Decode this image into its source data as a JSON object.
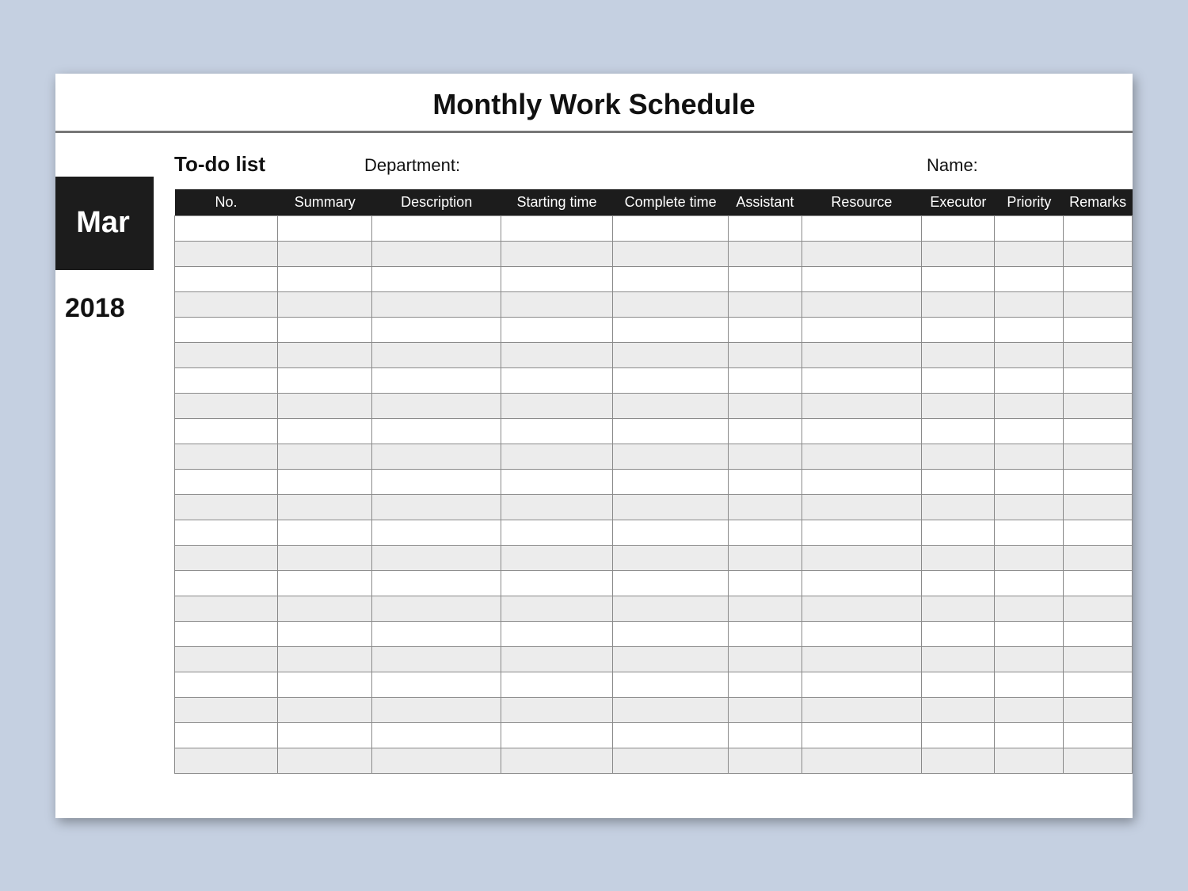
{
  "title": "Monthly Work Schedule",
  "sidebar": {
    "month": "Mar",
    "year": "2018"
  },
  "meta": {
    "list_label": "To-do list",
    "department_label": "Department:",
    "name_label": "Name:"
  },
  "columns": {
    "no": "No.",
    "summary": "Summary",
    "description": "Description",
    "starting_time": "Starting time",
    "complete_time": "Complete time",
    "assistant": "Assistant",
    "resource": "Resource",
    "executor": "Executor",
    "priority": "Priority",
    "remarks": "Remarks"
  },
  "row_count": 22
}
